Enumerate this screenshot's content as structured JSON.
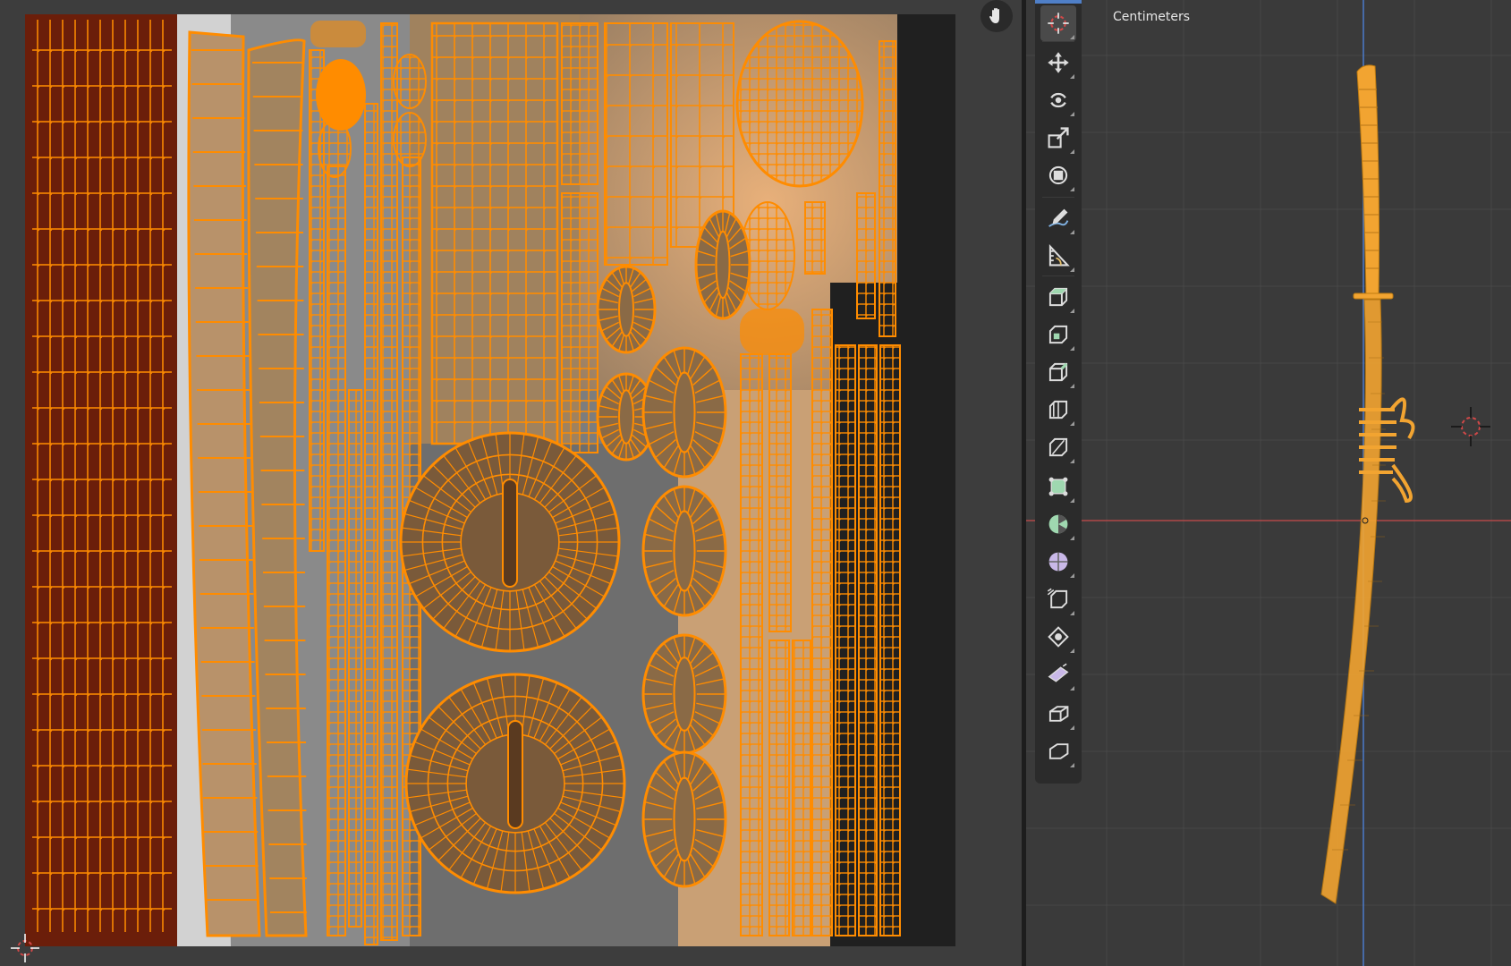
{
  "uv_editor": {
    "overlay_buttons": [
      {
        "name": "hand-icon"
      }
    ]
  },
  "viewport": {
    "units": "Centimeters",
    "toolbar": [
      {
        "name": "cursor-icon",
        "active": true
      },
      {
        "name": "move-icon"
      },
      {
        "name": "rotate-icon"
      },
      {
        "name": "scale-icon"
      },
      {
        "name": "transform-icon"
      },
      {
        "name": "annotate-icon"
      },
      {
        "name": "measure-icon"
      },
      {
        "name": "add-cube-icon"
      },
      {
        "name": "extrude-region-icon"
      },
      {
        "name": "inset-faces-icon"
      },
      {
        "name": "bevel-icon"
      },
      {
        "name": "loop-cut-icon"
      },
      {
        "name": "knife-icon"
      },
      {
        "name": "poly-build-icon"
      },
      {
        "name": "spin-icon"
      },
      {
        "name": "smooth-icon"
      },
      {
        "name": "edge-slide-icon"
      },
      {
        "name": "shrink-fatten-icon"
      },
      {
        "name": "shear-icon"
      },
      {
        "name": "rip-region-icon"
      }
    ]
  },
  "colors": {
    "uv_edge": "#ff8c00",
    "texture_dark": "#6b1e0a",
    "texture_tan": "#b8935f",
    "texture_grey": "#9c9c9c",
    "viewport_bg": "#3a3a3a",
    "x_axis": "#b04848",
    "y_axis": "#4a7ac9",
    "model_orange": "#f2a431"
  }
}
